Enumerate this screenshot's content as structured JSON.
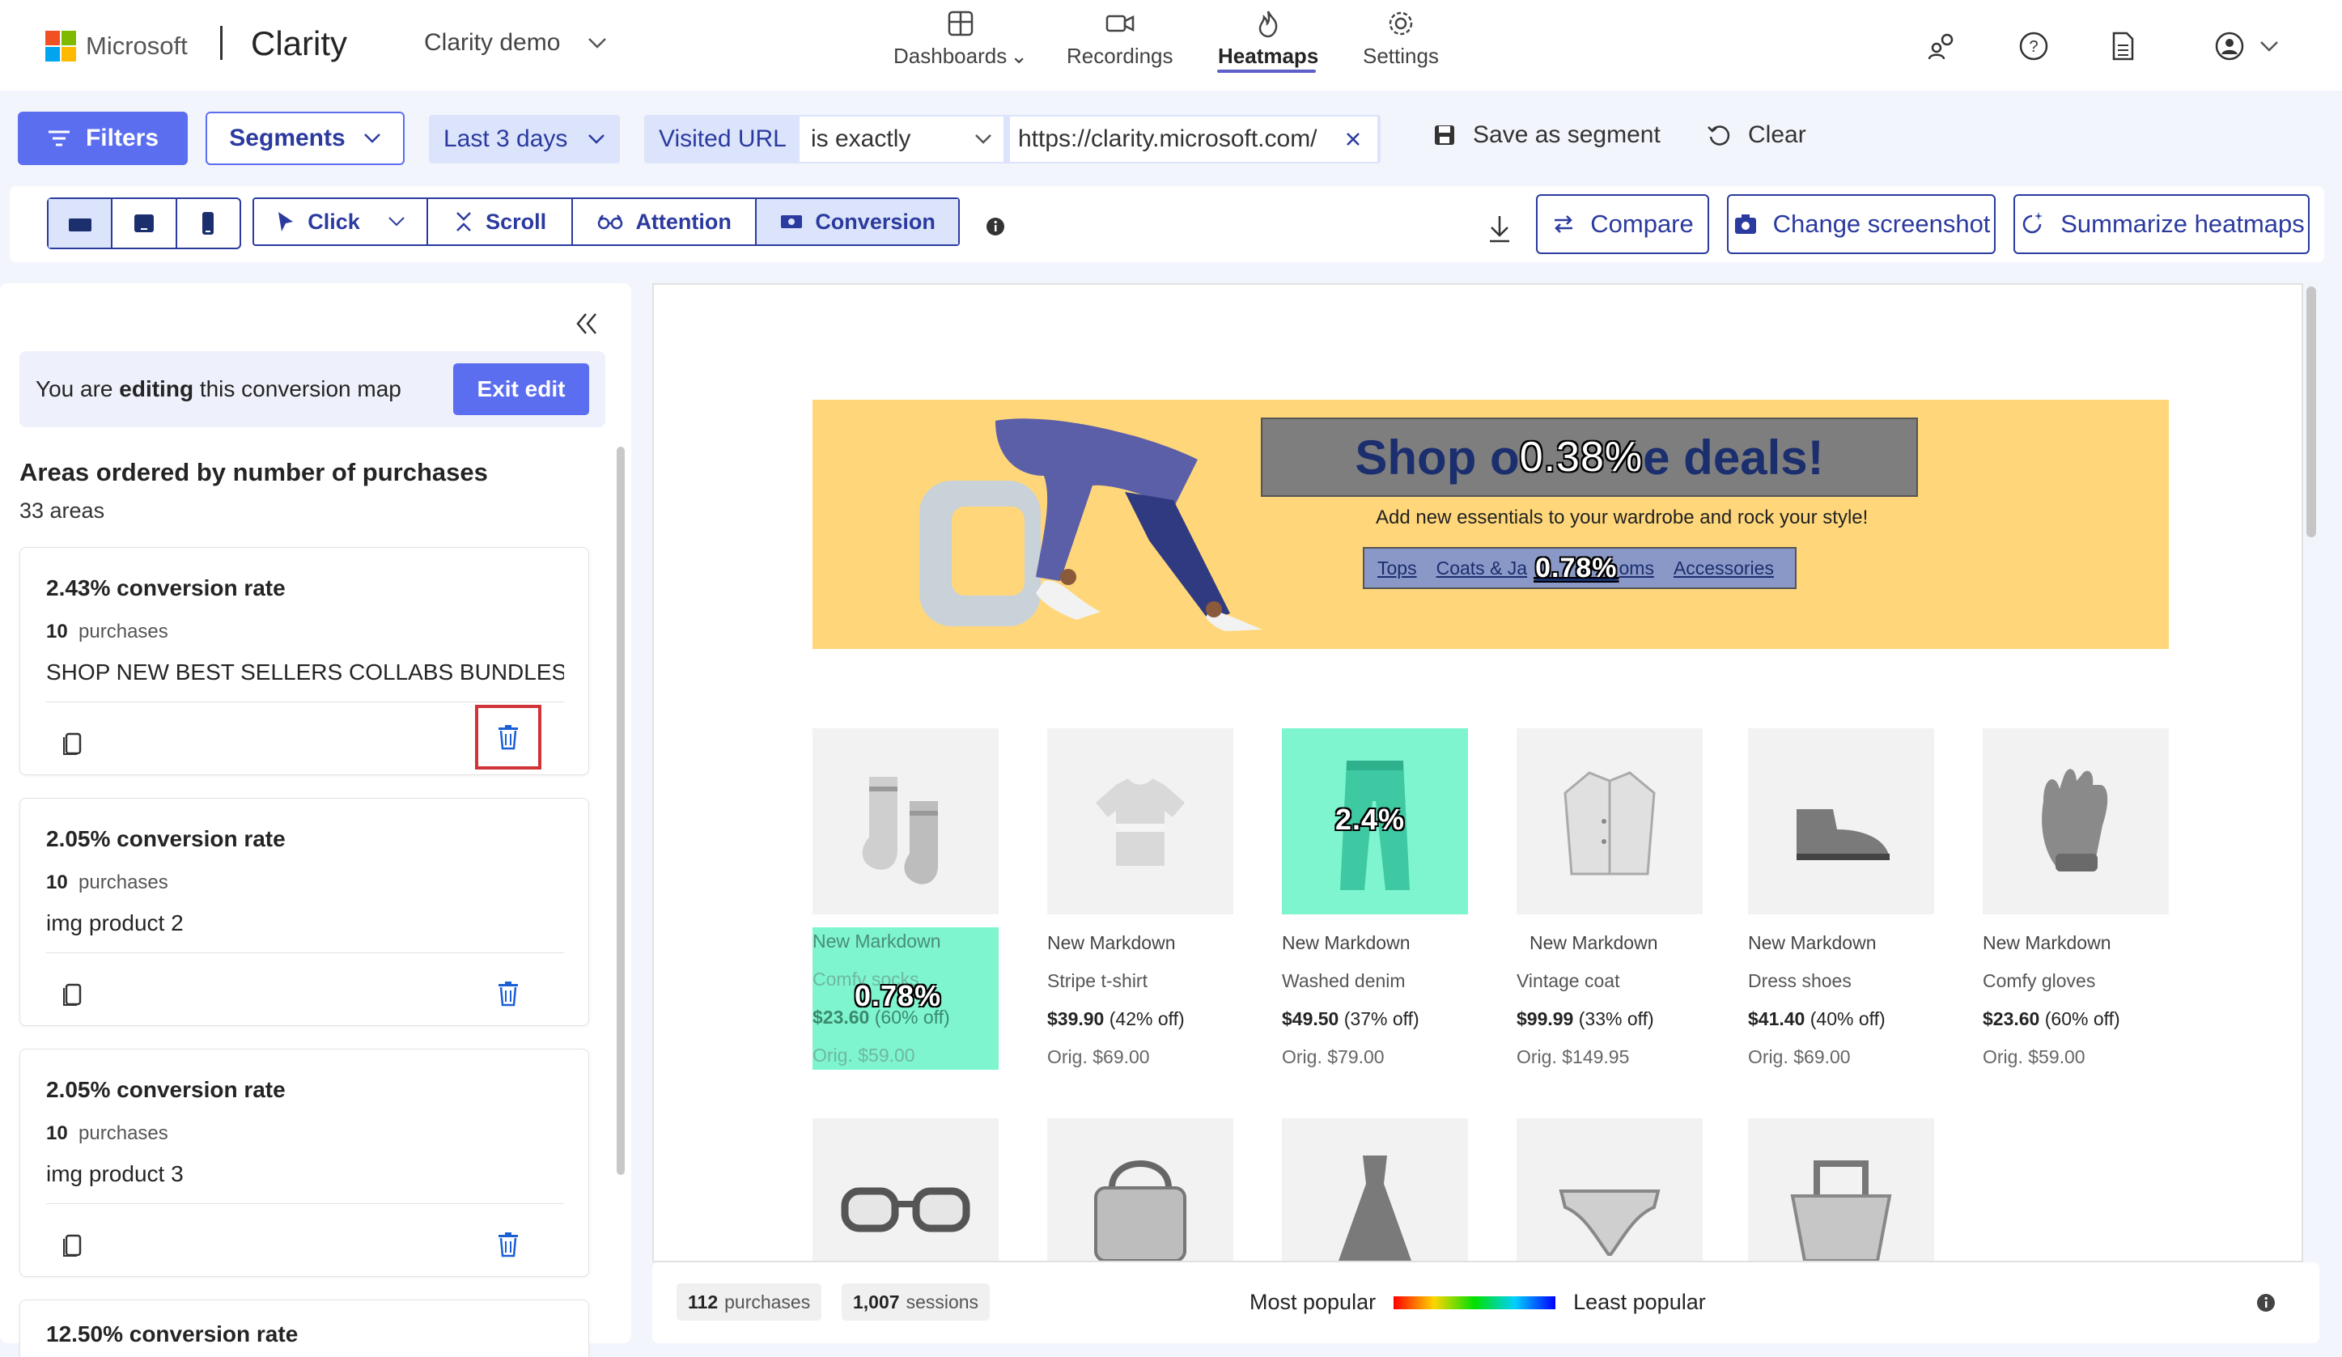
{
  "brand": {
    "company": "Microsoft",
    "product": "Clarity",
    "project": "Clarity demo"
  },
  "nav": {
    "items": [
      {
        "label": "Dashboards"
      },
      {
        "label": "Recordings"
      },
      {
        "label": "Heatmaps"
      },
      {
        "label": "Settings"
      }
    ],
    "active": "Heatmaps"
  },
  "filters": {
    "filters_label": "Filters",
    "segments_label": "Segments",
    "date_range": "Last 3 days",
    "field": "Visited URL",
    "operator": "is exactly",
    "value": "https://clarity.microsoft.com/",
    "save_segment": "Save as segment",
    "clear": "Clear"
  },
  "toolbar": {
    "modes": [
      "Click",
      "Scroll",
      "Attention",
      "Conversion"
    ],
    "active_mode": "Conversion",
    "compare": "Compare",
    "change_screenshot": "Change screenshot",
    "summarize": "Summarize heatmaps"
  },
  "edit": {
    "prefix": "You are ",
    "bold": "editing",
    "suffix": " this conversion map",
    "exit_label": "Exit edit"
  },
  "areas": {
    "title": "Areas ordered by number of purchases",
    "count": "33 areas",
    "cards": [
      {
        "rate": "2.43% conversion rate",
        "purchases": "10",
        "purchases_label": "purchases",
        "name": "SHOP NEW BEST SELLERS COLLABS BUNDLES AC..."
      },
      {
        "rate": "2.05% conversion rate",
        "purchases": "10",
        "purchases_label": "purchases",
        "name": "img product 2"
      },
      {
        "rate": "2.05% conversion rate",
        "purchases": "10",
        "purchases_label": "purchases",
        "name": "img product 3"
      },
      {
        "rate": "12.50% conversion rate",
        "purchases": "",
        "purchases_label": "",
        "name": ""
      }
    ]
  },
  "banner": {
    "title_left": "Shop o",
    "title_right": "e deals!",
    "title_pct": "0.38%",
    "subtitle": "Add new essentials to your wardrobe and rock your style!",
    "links": [
      "Tops",
      "Coats & Ja",
      "oms",
      "Accessories"
    ],
    "links_pct": "0.78%"
  },
  "products": [
    {
      "tag": "New Markdown",
      "name": "Comfy socks",
      "price": "$23.60",
      "off": "(60% off)",
      "orig": "Orig. $59.00",
      "pct": "0.78%"
    },
    {
      "tag": "New Markdown",
      "name": "Stripe t-shirt",
      "price": "$39.90",
      "off": "(42% off)",
      "orig": "Orig. $69.00"
    },
    {
      "tag": "New Markdown",
      "name": "Washed denim",
      "price": "$49.50",
      "off": "(37% off)",
      "orig": "Orig. $79.00",
      "pct": "2.4%"
    },
    {
      "tag": "New Markdown",
      "name": "Vintage coat",
      "price": "$99.99",
      "off": "(33% off)",
      "orig": "Orig. $149.95"
    },
    {
      "tag": "New Markdown",
      "name": "Dress shoes",
      "price": "$41.40",
      "off": "(40% off)",
      "orig": "Orig. $69.00"
    },
    {
      "tag": "New Markdown",
      "name": "Comfy gloves",
      "price": "$23.60",
      "off": "(60% off)",
      "orig": "Orig. $59.00"
    }
  ],
  "bottom": {
    "purchases_value": "112",
    "purchases_label": "purchases",
    "sessions_value": "1,007",
    "sessions_label": "sessions",
    "most": "Most popular",
    "least": "Least popular"
  },
  "colors": {
    "accent": "#5b6ef0",
    "accent_dark": "#2b3a9f",
    "heat": "#7ef5cf",
    "banner": "#ffd77a",
    "delete_highlight": "#d13438"
  }
}
